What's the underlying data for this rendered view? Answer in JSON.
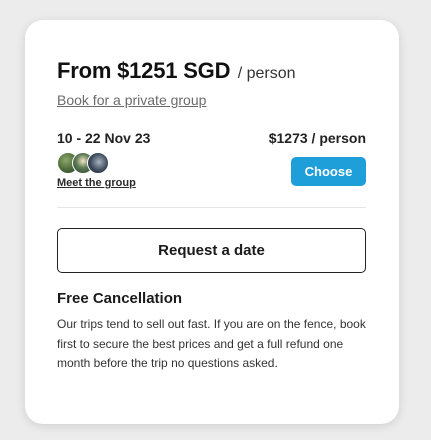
{
  "booking": {
    "price_from": "From $1251 SGD",
    "per_person": "/ person",
    "private_group_link": "Book for a private group"
  },
  "departure": {
    "dates": "10 - 22 Nov 23",
    "price": "$1273 / person",
    "meet_group_link": "Meet the group",
    "choose_label": "Choose"
  },
  "request_date_label": "Request a date",
  "cancellation": {
    "title": "Free Cancellation",
    "body": "Our trips tend to sell out fast. If you are on the fence, book first to secure the best prices and get a full refund one month before the trip no questions asked."
  },
  "colors": {
    "accent_button": "#1f9fd9",
    "card_background": "#ffffff",
    "page_background": "#ececec"
  }
}
